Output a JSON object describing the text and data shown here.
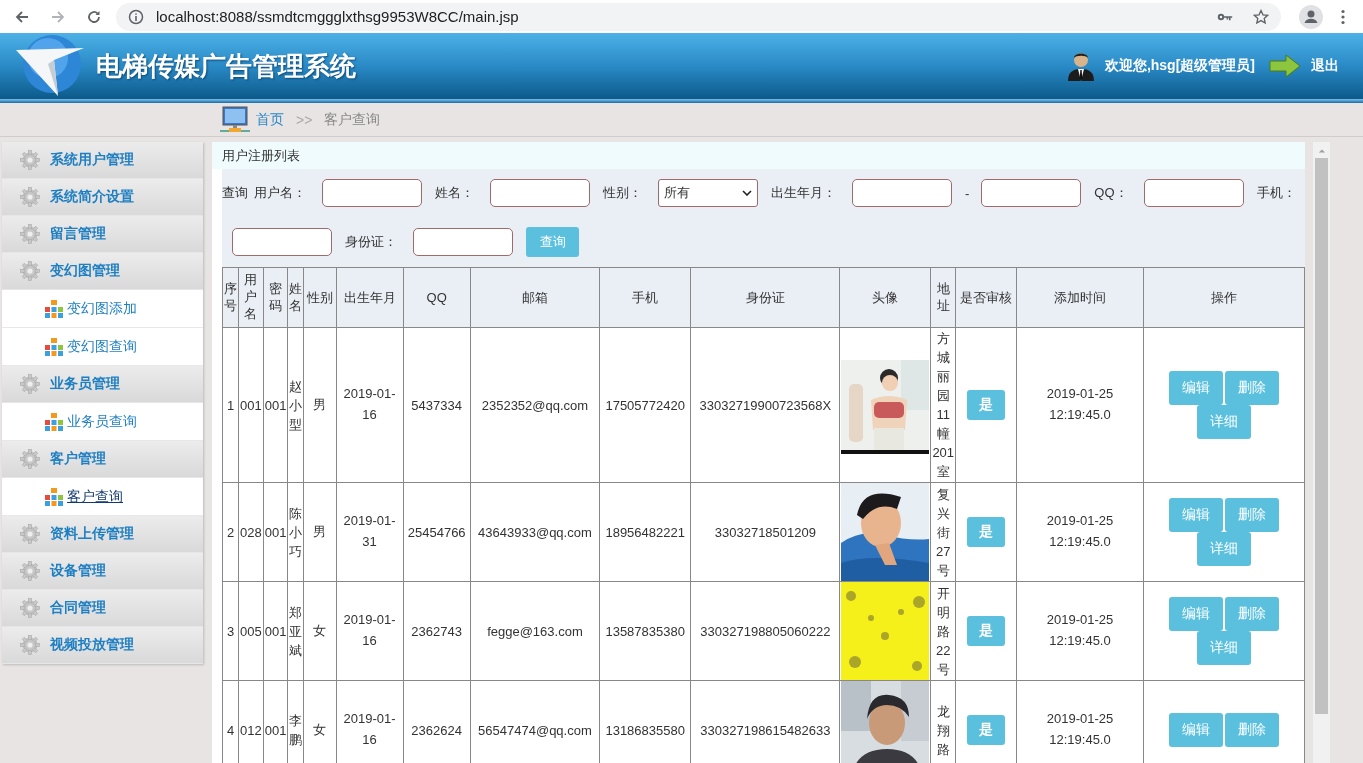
{
  "browser": {
    "url": "localhost:8088/ssmdtcmggglxthsg9953W8CC/main.jsp",
    "forward_disabled": true
  },
  "header": {
    "title": "电梯传媒广告管理系统",
    "welcome": "欢迎您,hsg[超级管理员]",
    "logout": "退出"
  },
  "breadcrumb": {
    "home": "首页",
    "separator": ">>",
    "current": "客户查询"
  },
  "sidebar": {
    "items": [
      {
        "label": "系统用户管理"
      },
      {
        "label": "系统简介设置"
      },
      {
        "label": "留言管理"
      },
      {
        "label": "变幻图管理",
        "children": [
          {
            "label": "变幻图添加",
            "selected": false
          },
          {
            "label": "变幻图查询",
            "selected": false
          }
        ]
      },
      {
        "label": "业务员管理",
        "children": [
          {
            "label": "业务员查询",
            "selected": false
          }
        ]
      },
      {
        "label": "客户管理",
        "children": [
          {
            "label": "客户查询",
            "selected": true
          }
        ]
      },
      {
        "label": "资料上传管理"
      },
      {
        "label": "设备管理"
      },
      {
        "label": "合同管理"
      },
      {
        "label": "视频投放管理"
      }
    ]
  },
  "panel": {
    "title": "用户注册列表"
  },
  "search": {
    "label": "查询",
    "fields": [
      {
        "kind": "text",
        "label": "用户名："
      },
      {
        "kind": "text",
        "label": "姓名："
      },
      {
        "kind": "select",
        "label": "性别：",
        "value": "所有"
      },
      {
        "kind": "range",
        "label": "出生年月：",
        "separator": "-"
      },
      {
        "kind": "text",
        "label": "QQ："
      },
      {
        "kind": "text",
        "label": "手机："
      },
      {
        "kind": "text",
        "label": "身份证："
      }
    ],
    "button": "查询"
  },
  "table": {
    "columns": [
      "序号",
      "用户名",
      "密码",
      "姓名",
      "性别",
      "出生年月",
      "QQ",
      "邮箱",
      "手机",
      "身份证",
      "头像",
      "地址",
      "是否审核",
      "添加时间",
      "操作"
    ],
    "rows": [
      {
        "no": "1",
        "username": "001",
        "password": "001",
        "name": "赵小型",
        "gender": "男",
        "birth": "2019-01-16",
        "qq": "5437334",
        "email": "2352352@qq.com",
        "phone": "17505772420",
        "idcard": "33032719900723568X",
        "address": "方城丽园11幢201室",
        "audited": "是",
        "added": "2019-01-25 12:19:45.0",
        "actions": [
          "编辑",
          "删除",
          "详细"
        ]
      },
      {
        "no": "2",
        "username": "028",
        "password": "001",
        "name": "陈小巧",
        "gender": "男",
        "birth": "2019-01-31",
        "qq": "25454766",
        "email": "43643933@qq.com",
        "phone": "18956482221",
        "idcard": "33032718501209",
        "address": "复兴街27号",
        "audited": "是",
        "added": "2019-01-25 12:19:45.0",
        "actions": [
          "编辑",
          "删除",
          "详细"
        ]
      },
      {
        "no": "3",
        "username": "005",
        "password": "001",
        "name": "郑亚斌",
        "gender": "女",
        "birth": "2019-01-16",
        "qq": "2362743",
        "email": "fegge@163.com",
        "phone": "13587835380",
        "idcard": "330327198805060222",
        "address": "开明路22号",
        "audited": "是",
        "added": "2019-01-25 12:19:45.0",
        "actions": [
          "编辑",
          "删除",
          "详细"
        ]
      },
      {
        "no": "4",
        "username": "012",
        "password": "001",
        "name": "李鹏",
        "gender": "女",
        "birth": "2019-01-16",
        "qq": "2362624",
        "email": "56547474@qq.com",
        "phone": "13186835580",
        "idcard": "330327198615482633",
        "address": "龙翔路",
        "audited": "是",
        "added": "2019-01-25 12:19:45.0",
        "actions": [
          "编辑",
          "删除"
        ]
      }
    ]
  }
}
